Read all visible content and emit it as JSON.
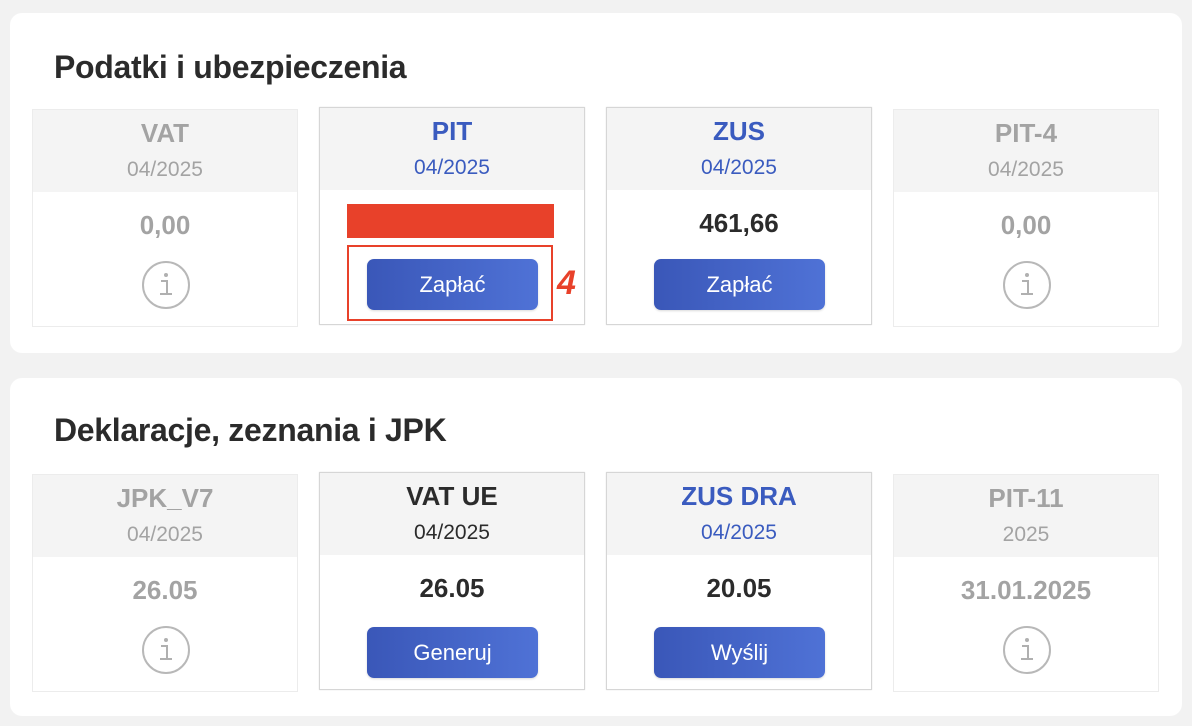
{
  "taxes_section": {
    "title": "Podatki i ubezpieczenia",
    "cards": [
      {
        "name": "VAT",
        "period": "04/2025",
        "amount": "0,00",
        "icon": "info-icon"
      },
      {
        "name": "PIT",
        "period": "04/2025",
        "amount": "",
        "button": "Zapłać",
        "annotation": "4"
      },
      {
        "name": "ZUS",
        "period": "04/2025",
        "amount": "461,66",
        "button": "Zapłać"
      },
      {
        "name": "PIT-4",
        "period": "04/2025",
        "amount": "0,00",
        "icon": "info-icon"
      }
    ]
  },
  "declarations_section": {
    "title": "Deklaracje, zeznania i JPK",
    "cards": [
      {
        "name": "JPK_V7",
        "period": "04/2025",
        "amount": "26.05",
        "icon": "info-icon"
      },
      {
        "name": "VAT UE",
        "period": "04/2025",
        "amount": "26.05",
        "button": "Generuj"
      },
      {
        "name": "ZUS DRA",
        "period": "04/2025",
        "amount": "20.05",
        "button": "Wyślij"
      },
      {
        "name": "PIT-11",
        "period": "2025",
        "amount": "31.01.2025",
        "icon": "info-icon"
      }
    ]
  },
  "colors": {
    "accent_blue": "#3a5bbf",
    "button_gradient_start": "#3a57b8",
    "button_gradient_end": "#4f72d6",
    "muted_text": "#a3a3a3",
    "annotation_red": "#e8412a"
  }
}
